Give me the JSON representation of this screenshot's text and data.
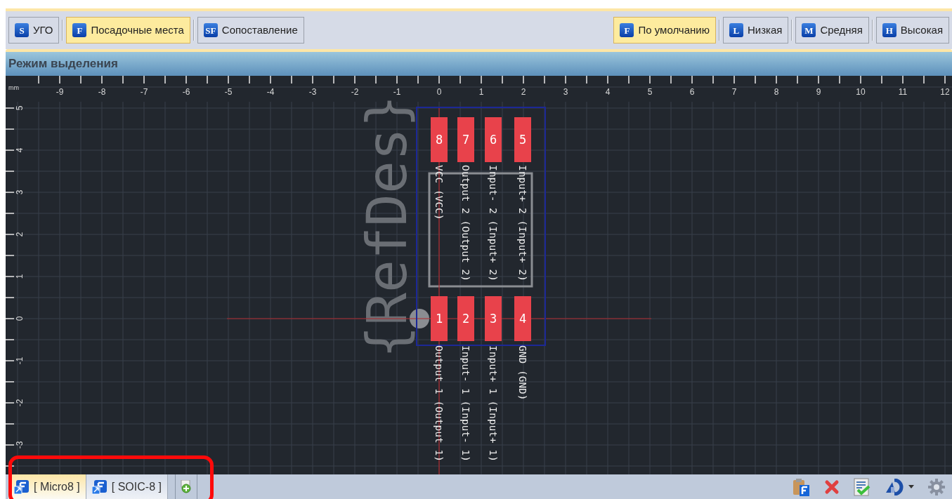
{
  "toolbar": {
    "left_buttons": [
      {
        "icon_letter": "S",
        "label": "УГО",
        "selected": false
      },
      {
        "icon_letter": "F",
        "label": "Посадочные места",
        "selected": true
      },
      {
        "icon_letter": "SF",
        "label": "Сопоставление",
        "selected": false
      }
    ],
    "right_buttons": [
      {
        "icon_letter": "F",
        "label": "По умолчанию",
        "selected": true
      },
      {
        "icon_letter": "L",
        "label": "Низкая",
        "selected": false
      },
      {
        "icon_letter": "M",
        "label": "Средняя",
        "selected": false
      },
      {
        "icon_letter": "H",
        "label": "Высокая",
        "selected": false
      }
    ]
  },
  "panel": {
    "title": "Режим выделения"
  },
  "canvas": {
    "unit": "mm",
    "x_ruler": [
      "-9",
      "-8",
      "-7",
      "-6",
      "-5",
      "-4",
      "-3",
      "-2",
      "-1",
      "0",
      "1",
      "2",
      "3",
      "4",
      "5",
      "6",
      "7",
      "8",
      "9",
      "10",
      "11",
      "12"
    ],
    "y_ruler": [
      "5",
      "4",
      "3",
      "2",
      "1",
      "0",
      "-1",
      "-2",
      "-3"
    ],
    "refdes": "{RefDes}",
    "top_pads": [
      {
        "number": "8",
        "label": "VCC (VCC)"
      },
      {
        "number": "7",
        "label": "Output 2 (Output 2)"
      },
      {
        "number": "6",
        "label": "Input- 2 (Input+ 2)"
      },
      {
        "number": "5",
        "label": "Input+ 2 (Input+ 2)"
      }
    ],
    "bottom_pads": [
      {
        "number": "1",
        "label": "Output 1 (Output 1)"
      },
      {
        "number": "2",
        "label": "Input- 1 (Input- 1)"
      },
      {
        "number": "3",
        "label": "Input+ 1 (Input+ 1)"
      },
      {
        "number": "4",
        "label": "GND (GND)"
      }
    ]
  },
  "bottom_tabs": [
    {
      "label": "[ Micro8 ]",
      "selected": true
    },
    {
      "label": "[ SOIC-8 ]",
      "selected": false
    }
  ]
}
